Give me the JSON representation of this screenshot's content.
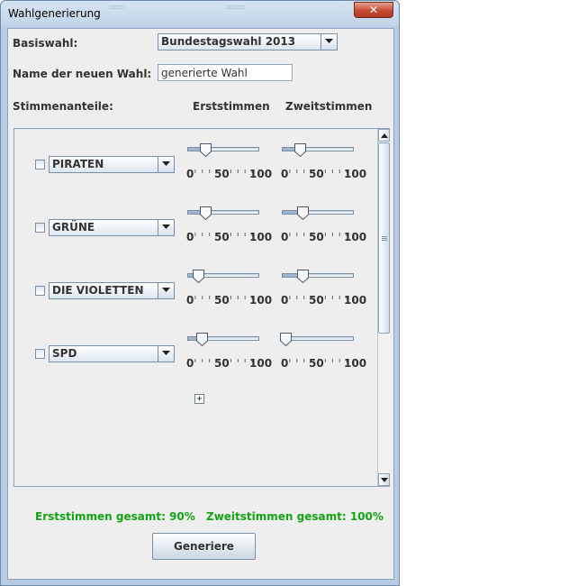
{
  "window": {
    "title": "Wahlgenerierung"
  },
  "form": {
    "basiswahl_label": "Basiswahl:",
    "basiswahl_value": "Bundestagswahl 2013",
    "name_label": "Name der neuen Wahl:",
    "name_value": "generierte Wahl",
    "stimmenanteile_label": "Stimmenanteile:",
    "col_erst": "Erststimmen",
    "col_zweit": "Zweitstimmen"
  },
  "slider_ticks": {
    "min": "0",
    "mid": "50",
    "max": "100"
  },
  "parties": [
    {
      "name": "PIRATEN",
      "checked": false,
      "erst": 25,
      "zweit": 25
    },
    {
      "name": "GRÜNE",
      "checked": false,
      "erst": 25,
      "zweit": 30
    },
    {
      "name": "DIE VIOLETTEN",
      "checked": false,
      "erst": 15,
      "zweit": 30
    },
    {
      "name": "SPD",
      "checked": false,
      "erst": 20,
      "zweit": 5
    }
  ],
  "totals": {
    "erst": "Erststimmen gesamt: 90%",
    "zweit": "Zweitstimmen gesamt: 100%"
  },
  "generate_button": "Generiere",
  "icons": {
    "close": "close-icon",
    "dropdown": "chevron-down-icon",
    "add": "plus-icon"
  },
  "colors": {
    "total_text": "#14a314",
    "title_bar": "#c3d6ea"
  }
}
